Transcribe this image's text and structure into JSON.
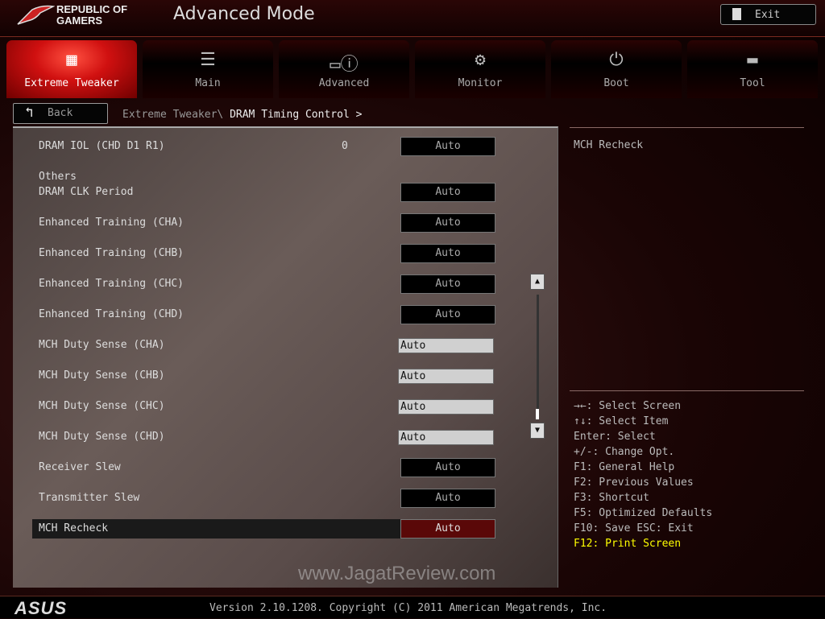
{
  "header": {
    "brand": [
      "REPUBLIC OF",
      "GAMERS"
    ],
    "mode_title": "Advanced Mode",
    "exit_label": "Exit"
  },
  "tabs": [
    {
      "label": "Extreme Tweaker",
      "icon": "fan-icon",
      "active": true
    },
    {
      "label": "Main",
      "icon": "list-icon"
    },
    {
      "label": "Advanced",
      "icon": "monitor-info-icon"
    },
    {
      "label": "Monitor",
      "icon": "thermometer-icon"
    },
    {
      "label": "Boot",
      "icon": "power-icon"
    },
    {
      "label": "Tool",
      "icon": "toolbox-icon"
    }
  ],
  "nav": {
    "back_label": "Back",
    "breadcrumb_parent": "Extreme Tweaker\\",
    "breadcrumb_current": "DRAM Timing Control >"
  },
  "settings": {
    "top": {
      "name": "DRAM IOL (CHD D1 R1)",
      "number": "0",
      "value": "Auto"
    },
    "group_label": "Others",
    "rows": [
      {
        "name": "DRAM CLK Period",
        "value": "Auto",
        "type": "select"
      },
      {
        "name": "Enhanced Training (CHA)",
        "value": "Auto",
        "type": "select"
      },
      {
        "name": "Enhanced Training (CHB)",
        "value": "Auto",
        "type": "select"
      },
      {
        "name": "Enhanced Training (CHC)",
        "value": "Auto",
        "type": "select"
      },
      {
        "name": "Enhanced Training (CHD)",
        "value": "Auto",
        "type": "select"
      },
      {
        "name": "MCH Duty Sense (CHA)",
        "value": "Auto",
        "type": "input"
      },
      {
        "name": "MCH Duty Sense (CHB)",
        "value": "Auto",
        "type": "input"
      },
      {
        "name": "MCH Duty Sense (CHC)",
        "value": "Auto",
        "type": "input"
      },
      {
        "name": "MCH Duty Sense (CHD)",
        "value": "Auto",
        "type": "input"
      },
      {
        "name": "Receiver Slew",
        "value": "Auto",
        "type": "select"
      },
      {
        "name": "Transmitter Slew",
        "value": "Auto",
        "type": "select"
      },
      {
        "name": "MCH Recheck",
        "value": "Auto",
        "type": "select",
        "selected": true
      }
    ]
  },
  "watermark": "www.JagatReview.com",
  "help": {
    "text": "MCH Recheck"
  },
  "keys": [
    "→←: Select Screen",
    "↑↓: Select Item",
    "Enter: Select",
    "+/-: Change Opt.",
    "F1: General Help",
    "F2: Previous Values",
    "F3: Shortcut",
    "F5: Optimized Defaults",
    "F10: Save  ESC: Exit",
    "F12: Print Screen"
  ],
  "footer": {
    "logo": "ASUS",
    "version": "Version 2.10.1208. Copyright (C) 2011 American Megatrends, Inc."
  }
}
